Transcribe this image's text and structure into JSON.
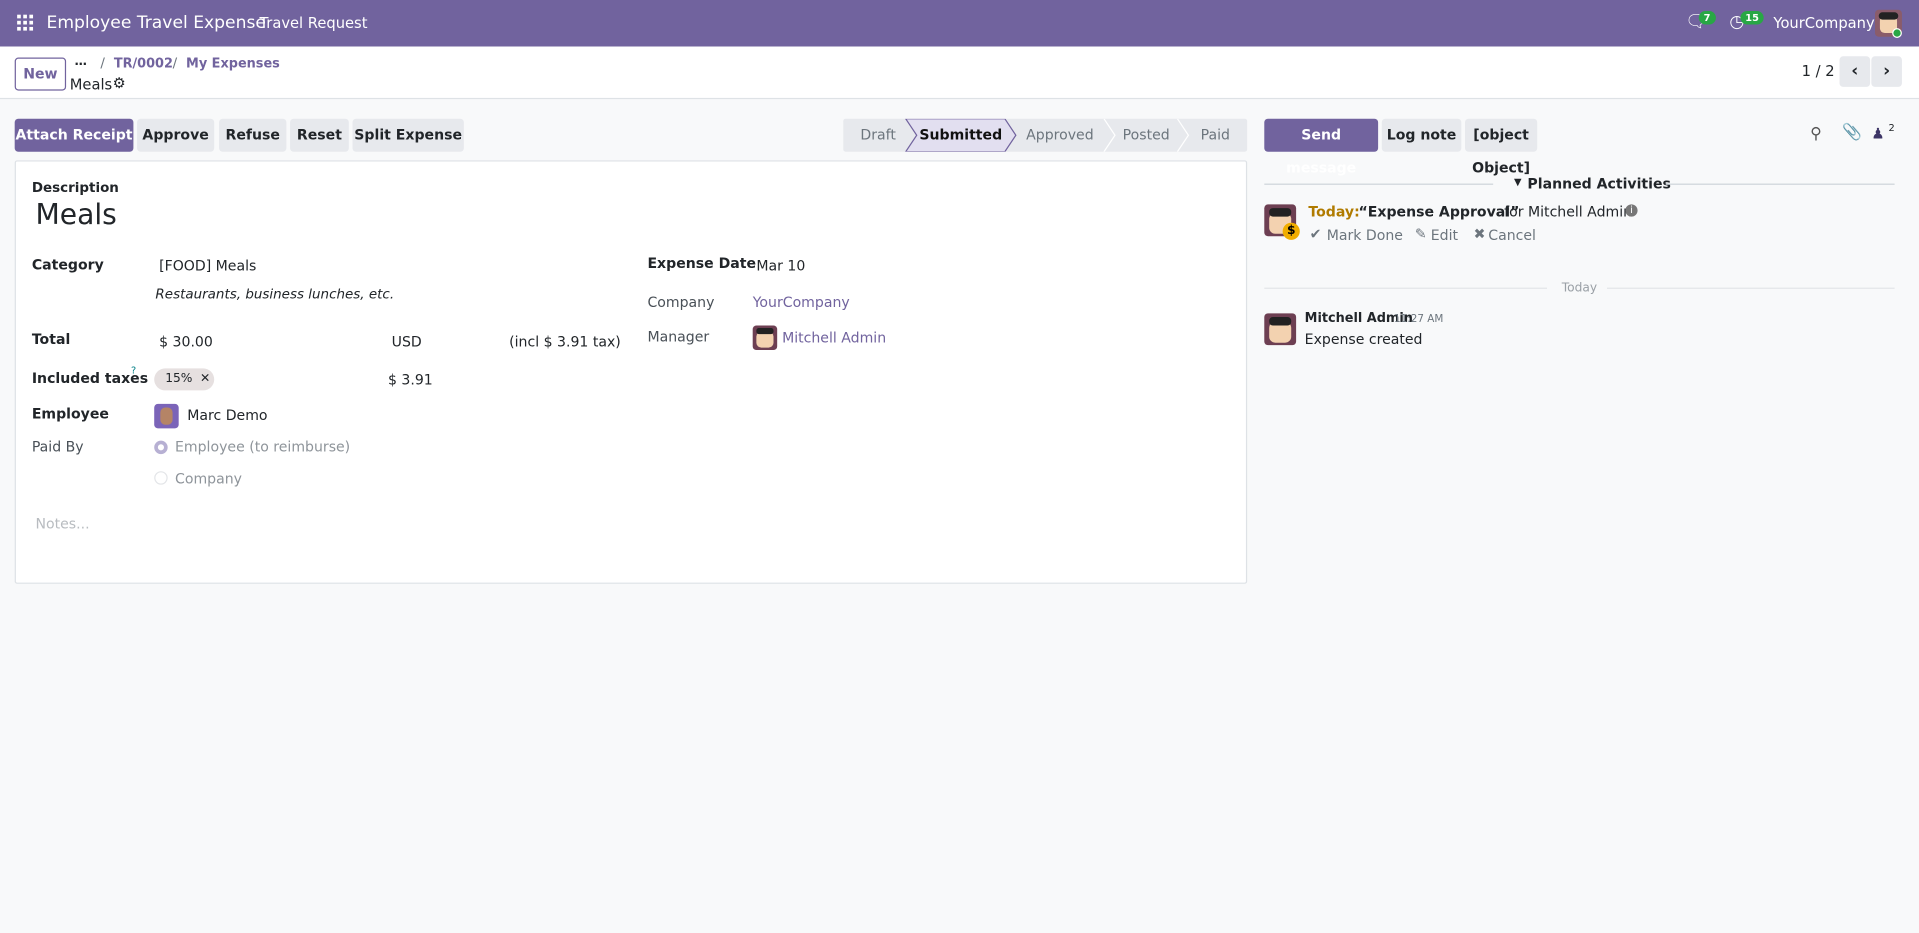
{
  "navbar": {
    "app_title": "Employee Travel Expense",
    "menu": "Travel Request",
    "messages_count": "7",
    "activities_count": "15",
    "company": "YourCompany"
  },
  "control": {
    "new_label": "New",
    "breadcrumb_more": "…",
    "breadcrumb": [
      "TR/0002",
      "My Expenses"
    ],
    "record_name": "Meals",
    "pager": "1 / 2"
  },
  "actions": [
    "Attach Receipt",
    "Approve",
    "Refuse",
    "Reset",
    "Split Expense"
  ],
  "statusbar": {
    "stages": [
      "Draft",
      "Submitted",
      "Approved",
      "Posted",
      "Paid"
    ],
    "current": "Submitted"
  },
  "form": {
    "description_label": "Description",
    "description": "Meals",
    "category_label": "Category",
    "category": "[FOOD] Meals",
    "category_hint": "Restaurants, business lunches, etc.",
    "total_label": "Total",
    "total": "$ 30.00",
    "currency": "USD",
    "tax_incl": "(incl $ 3.91 tax)",
    "taxes_label": "Included taxes",
    "taxes_help": "?",
    "tax_tag": "15%",
    "tax_amount": "$ 3.91",
    "employee_label": "Employee",
    "employee": "Marc Demo",
    "paid_by_label": "Paid By",
    "paid_by_options": [
      "Employee (to reimburse)",
      "Company"
    ],
    "paid_by_selected": "Employee (to reimburse)",
    "expense_date_label": "Expense Date",
    "expense_date": "Mar 10",
    "company_label": "Company",
    "company": "YourCompany",
    "manager_label": "Manager",
    "manager": "Mitchell Admin",
    "notes_placeholder": "Notes..."
  },
  "chatter": {
    "send_message": "Send message",
    "log_note": "Log note",
    "activity": {
      "when": "Today:",
      "name": "“Expense Approval”",
      "for": "for Mitchell Admin",
      "mark_done": "Mark Done",
      "edit": "Edit",
      "cancel": "Cancel"
    },
    "followers_count": "2",
    "planned_title": "Planned Activities",
    "separator": "Today",
    "message": {
      "author": "Mitchell Admin",
      "time": "11:27 AM",
      "body": "Expense created"
    }
  },
  "colors": {
    "brand": "#71639e",
    "activity_today": "#b07b00"
  }
}
